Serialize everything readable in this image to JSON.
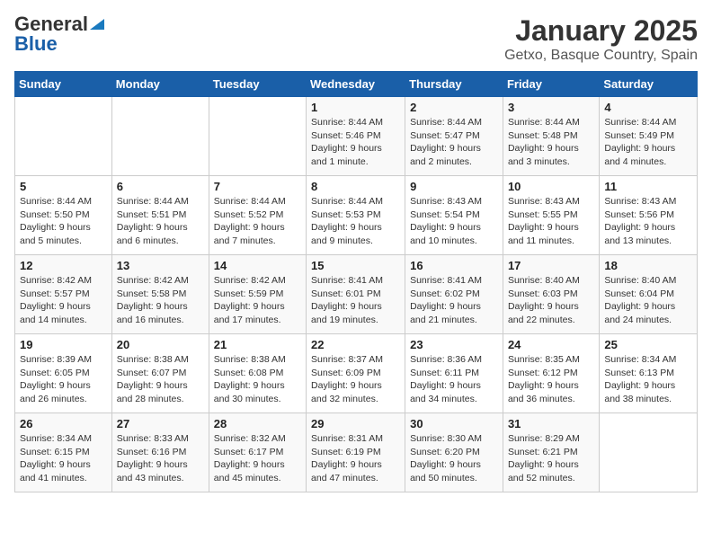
{
  "header": {
    "logo_general": "General",
    "logo_blue": "Blue",
    "title": "January 2025",
    "subtitle": "Getxo, Basque Country, Spain"
  },
  "columns": [
    "Sunday",
    "Monday",
    "Tuesday",
    "Wednesday",
    "Thursday",
    "Friday",
    "Saturday"
  ],
  "weeks": [
    [
      {
        "day": "",
        "sunrise": "",
        "sunset": "",
        "daylight": ""
      },
      {
        "day": "",
        "sunrise": "",
        "sunset": "",
        "daylight": ""
      },
      {
        "day": "",
        "sunrise": "",
        "sunset": "",
        "daylight": ""
      },
      {
        "day": "1",
        "sunrise": "Sunrise: 8:44 AM",
        "sunset": "Sunset: 5:46 PM",
        "daylight": "Daylight: 9 hours and 1 minute."
      },
      {
        "day": "2",
        "sunrise": "Sunrise: 8:44 AM",
        "sunset": "Sunset: 5:47 PM",
        "daylight": "Daylight: 9 hours and 2 minutes."
      },
      {
        "day": "3",
        "sunrise": "Sunrise: 8:44 AM",
        "sunset": "Sunset: 5:48 PM",
        "daylight": "Daylight: 9 hours and 3 minutes."
      },
      {
        "day": "4",
        "sunrise": "Sunrise: 8:44 AM",
        "sunset": "Sunset: 5:49 PM",
        "daylight": "Daylight: 9 hours and 4 minutes."
      }
    ],
    [
      {
        "day": "5",
        "sunrise": "Sunrise: 8:44 AM",
        "sunset": "Sunset: 5:50 PM",
        "daylight": "Daylight: 9 hours and 5 minutes."
      },
      {
        "day": "6",
        "sunrise": "Sunrise: 8:44 AM",
        "sunset": "Sunset: 5:51 PM",
        "daylight": "Daylight: 9 hours and 6 minutes."
      },
      {
        "day": "7",
        "sunrise": "Sunrise: 8:44 AM",
        "sunset": "Sunset: 5:52 PM",
        "daylight": "Daylight: 9 hours and 7 minutes."
      },
      {
        "day": "8",
        "sunrise": "Sunrise: 8:44 AM",
        "sunset": "Sunset: 5:53 PM",
        "daylight": "Daylight: 9 hours and 9 minutes."
      },
      {
        "day": "9",
        "sunrise": "Sunrise: 8:43 AM",
        "sunset": "Sunset: 5:54 PM",
        "daylight": "Daylight: 9 hours and 10 minutes."
      },
      {
        "day": "10",
        "sunrise": "Sunrise: 8:43 AM",
        "sunset": "Sunset: 5:55 PM",
        "daylight": "Daylight: 9 hours and 11 minutes."
      },
      {
        "day": "11",
        "sunrise": "Sunrise: 8:43 AM",
        "sunset": "Sunset: 5:56 PM",
        "daylight": "Daylight: 9 hours and 13 minutes."
      }
    ],
    [
      {
        "day": "12",
        "sunrise": "Sunrise: 8:42 AM",
        "sunset": "Sunset: 5:57 PM",
        "daylight": "Daylight: 9 hours and 14 minutes."
      },
      {
        "day": "13",
        "sunrise": "Sunrise: 8:42 AM",
        "sunset": "Sunset: 5:58 PM",
        "daylight": "Daylight: 9 hours and 16 minutes."
      },
      {
        "day": "14",
        "sunrise": "Sunrise: 8:42 AM",
        "sunset": "Sunset: 5:59 PM",
        "daylight": "Daylight: 9 hours and 17 minutes."
      },
      {
        "day": "15",
        "sunrise": "Sunrise: 8:41 AM",
        "sunset": "Sunset: 6:01 PM",
        "daylight": "Daylight: 9 hours and 19 minutes."
      },
      {
        "day": "16",
        "sunrise": "Sunrise: 8:41 AM",
        "sunset": "Sunset: 6:02 PM",
        "daylight": "Daylight: 9 hours and 21 minutes."
      },
      {
        "day": "17",
        "sunrise": "Sunrise: 8:40 AM",
        "sunset": "Sunset: 6:03 PM",
        "daylight": "Daylight: 9 hours and 22 minutes."
      },
      {
        "day": "18",
        "sunrise": "Sunrise: 8:40 AM",
        "sunset": "Sunset: 6:04 PM",
        "daylight": "Daylight: 9 hours and 24 minutes."
      }
    ],
    [
      {
        "day": "19",
        "sunrise": "Sunrise: 8:39 AM",
        "sunset": "Sunset: 6:05 PM",
        "daylight": "Daylight: 9 hours and 26 minutes."
      },
      {
        "day": "20",
        "sunrise": "Sunrise: 8:38 AM",
        "sunset": "Sunset: 6:07 PM",
        "daylight": "Daylight: 9 hours and 28 minutes."
      },
      {
        "day": "21",
        "sunrise": "Sunrise: 8:38 AM",
        "sunset": "Sunset: 6:08 PM",
        "daylight": "Daylight: 9 hours and 30 minutes."
      },
      {
        "day": "22",
        "sunrise": "Sunrise: 8:37 AM",
        "sunset": "Sunset: 6:09 PM",
        "daylight": "Daylight: 9 hours and 32 minutes."
      },
      {
        "day": "23",
        "sunrise": "Sunrise: 8:36 AM",
        "sunset": "Sunset: 6:11 PM",
        "daylight": "Daylight: 9 hours and 34 minutes."
      },
      {
        "day": "24",
        "sunrise": "Sunrise: 8:35 AM",
        "sunset": "Sunset: 6:12 PM",
        "daylight": "Daylight: 9 hours and 36 minutes."
      },
      {
        "day": "25",
        "sunrise": "Sunrise: 8:34 AM",
        "sunset": "Sunset: 6:13 PM",
        "daylight": "Daylight: 9 hours and 38 minutes."
      }
    ],
    [
      {
        "day": "26",
        "sunrise": "Sunrise: 8:34 AM",
        "sunset": "Sunset: 6:15 PM",
        "daylight": "Daylight: 9 hours and 41 minutes."
      },
      {
        "day": "27",
        "sunrise": "Sunrise: 8:33 AM",
        "sunset": "Sunset: 6:16 PM",
        "daylight": "Daylight: 9 hours and 43 minutes."
      },
      {
        "day": "28",
        "sunrise": "Sunrise: 8:32 AM",
        "sunset": "Sunset: 6:17 PM",
        "daylight": "Daylight: 9 hours and 45 minutes."
      },
      {
        "day": "29",
        "sunrise": "Sunrise: 8:31 AM",
        "sunset": "Sunset: 6:19 PM",
        "daylight": "Daylight: 9 hours and 47 minutes."
      },
      {
        "day": "30",
        "sunrise": "Sunrise: 8:30 AM",
        "sunset": "Sunset: 6:20 PM",
        "daylight": "Daylight: 9 hours and 50 minutes."
      },
      {
        "day": "31",
        "sunrise": "Sunrise: 8:29 AM",
        "sunset": "Sunset: 6:21 PM",
        "daylight": "Daylight: 9 hours and 52 minutes."
      },
      {
        "day": "",
        "sunrise": "",
        "sunset": "",
        "daylight": ""
      }
    ]
  ]
}
